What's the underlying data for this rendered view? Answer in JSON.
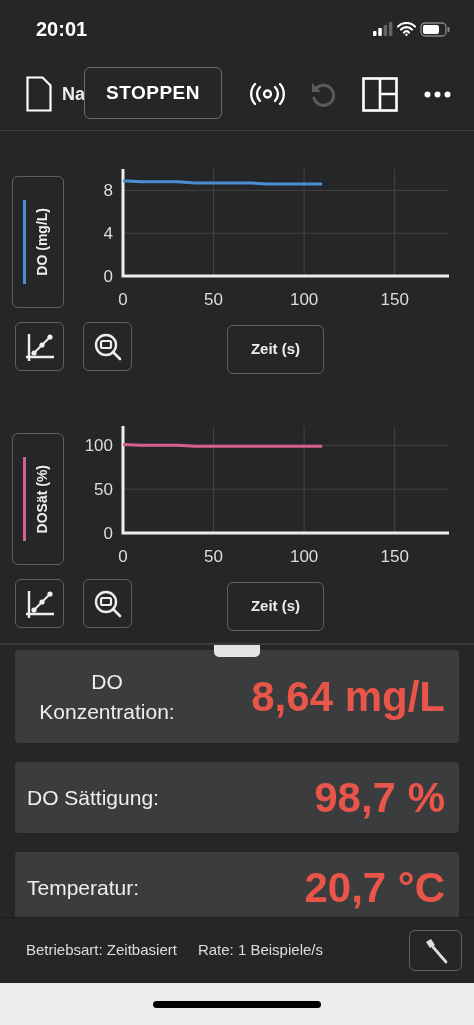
{
  "status_bar": {
    "time": "20:01"
  },
  "toolbar": {
    "file_name": "Na",
    "stop_button": "STOPPEN",
    "undo": {
      "disabled": true
    }
  },
  "graphs": [
    {
      "chart_data": {
        "type": "line",
        "ylabel": "DO (mg/L)",
        "xlabel": "Zeit (s)",
        "xlim": [
          0,
          180
        ],
        "ylim": [
          0,
          10
        ],
        "xticks": [
          0,
          50,
          100,
          150
        ],
        "yticks": [
          0,
          4,
          8
        ],
        "x": [
          0,
          10,
          20,
          30,
          40,
          50,
          60,
          70,
          80,
          90,
          100,
          110
        ],
        "grid": true,
        "series": [
          {
            "color": "#4a8fd4",
            "values": [
              8.9,
              8.8,
              8.8,
              8.8,
              8.7,
              8.7,
              8.7,
              8.7,
              8.6,
              8.6,
              8.6,
              8.6
            ]
          }
        ]
      }
    },
    {
      "chart_data": {
        "type": "line",
        "ylabel": "DOSät (%)",
        "xlabel": "Zeit (s)",
        "xlim": [
          0,
          180
        ],
        "ylim": [
          0,
          122
        ],
        "xticks": [
          0,
          50,
          100,
          150
        ],
        "yticks": [
          0,
          50,
          100
        ],
        "x": [
          0,
          10,
          20,
          30,
          40,
          50,
          60,
          70,
          80,
          90,
          100,
          110
        ],
        "grid": true,
        "series": [
          {
            "color": "#d9608e",
            "values": [
              101,
              100,
              100,
              100,
              99,
              99,
              99,
              99,
              99,
              99,
              99,
              99
            ]
          }
        ]
      }
    }
  ],
  "meters": [
    {
      "label": "DO Konzentration:",
      "value": "8,64 mg/L"
    },
    {
      "label": "DO Sättigung:",
      "value": "98,7 %"
    },
    {
      "label": "Temperatur:",
      "value": "20,7 °C"
    }
  ],
  "footer": {
    "mode": "Betriebsart: Zeitbasiert",
    "rate": "Rate: 1 Beispiele/s"
  }
}
